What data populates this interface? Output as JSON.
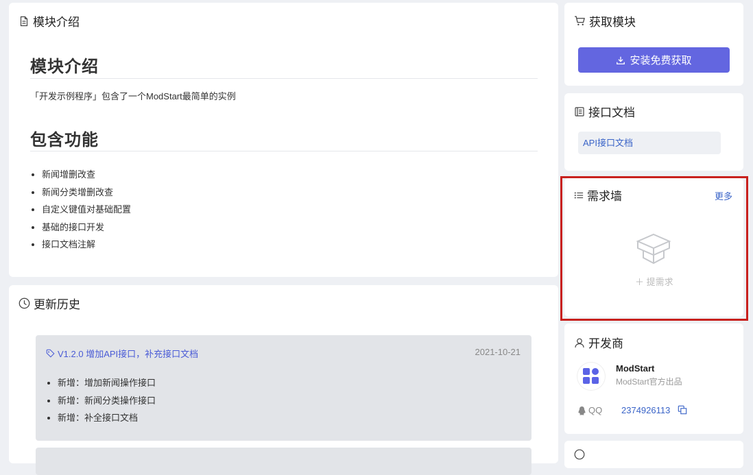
{
  "intro": {
    "card_title": "模块介绍",
    "heading": "模块介绍",
    "description": "「开发示例程序」包含了一个ModStart最简单的实例",
    "features_heading": "包含功能",
    "features": [
      "新闻增删改查",
      "新闻分类增删改查",
      "自定义键值对基础配置",
      "基础的接口开发",
      "接口文档注解"
    ]
  },
  "history": {
    "card_title": "更新历史",
    "entries": [
      {
        "version": "V1.2.0 增加API接口，补充接口文档",
        "date": "2021-10-21",
        "changes": [
          "新增：增加新闻操作接口",
          "新增：新闻分类操作接口",
          "新增：补全接口文档"
        ]
      }
    ]
  },
  "get_module": {
    "card_title": "获取模块",
    "install_label": "安装免费获取"
  },
  "api_docs": {
    "card_title": "接口文档",
    "link_label": "API接口文档"
  },
  "demand_wall": {
    "card_title": "需求墙",
    "more_label": "更多",
    "add_label": "＋ 提需求"
  },
  "developer": {
    "card_title": "开发商",
    "name": "ModStart",
    "subtitle": "ModStart官方出品",
    "qq_label": "QQ",
    "qq_number": "2374926113"
  },
  "colors": {
    "accent": "#6366e0",
    "link": "#3a64c8",
    "highlight": "#c8201d"
  }
}
